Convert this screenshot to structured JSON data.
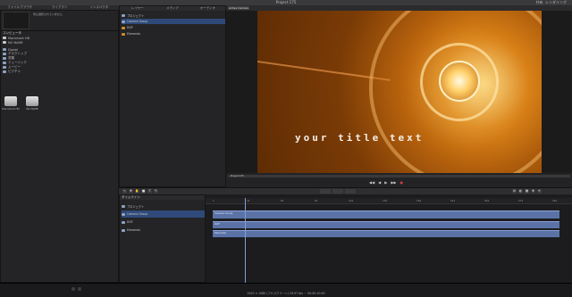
{
  "window": {
    "title": "Project 175",
    "right_menu": [
      "共有",
      "レンダリング"
    ]
  },
  "sidebar": {
    "tabs": [
      "ファイルブラウザ",
      "ライブラリ",
      "インスペクタ"
    ],
    "preview_text": "何も選択されていません",
    "section_title": "コンピュータ",
    "sources": [
      "Macintosh HD",
      "NO NAME",
      "Daniel",
      "デスクトップ",
      "書類",
      "ミュージック",
      "ムービー",
      "ピクチャ"
    ],
    "thumbnails": [
      "Macintosh HD",
      "NO NAME"
    ]
  },
  "layers": {
    "tabs": [
      "レイヤー",
      "メディア",
      "オーディオ"
    ],
    "rows": [
      {
        "label": "プロジェクト",
        "selected": false
      },
      {
        "label": "Camera Group",
        "selected": true
      },
      {
        "label": "DOF",
        "selected": false
      },
      {
        "label": "Elements",
        "selected": false
      }
    ]
  },
  "viewer": {
    "zoom": "Active Camera",
    "title_text": "your title text",
    "scrub_label": "Project 175",
    "transport": [
      "◀◀",
      "◀",
      "▶",
      "▶▶",
      "●"
    ]
  },
  "timeline_header": {
    "title": "タイムライン",
    "rows": [
      {
        "label": "プロジェクト",
        "selected": false
      },
      {
        "label": "Camera Group",
        "selected": true
      },
      {
        "label": "DOF",
        "selected": false
      },
      {
        "label": "Elements",
        "selected": false
      }
    ]
  },
  "timeline": {
    "ticks": [
      "1",
      "31",
      "61",
      "91",
      "121",
      "151",
      "181",
      "211",
      "241",
      "271",
      "301"
    ],
    "tracks": [
      "Camera Group",
      "DOF",
      "Elements"
    ]
  },
  "statusbar": {
    "text": "1920 × 1080 (フルスクリーン) 29.97 fps ・ 00:00:10:00"
  }
}
